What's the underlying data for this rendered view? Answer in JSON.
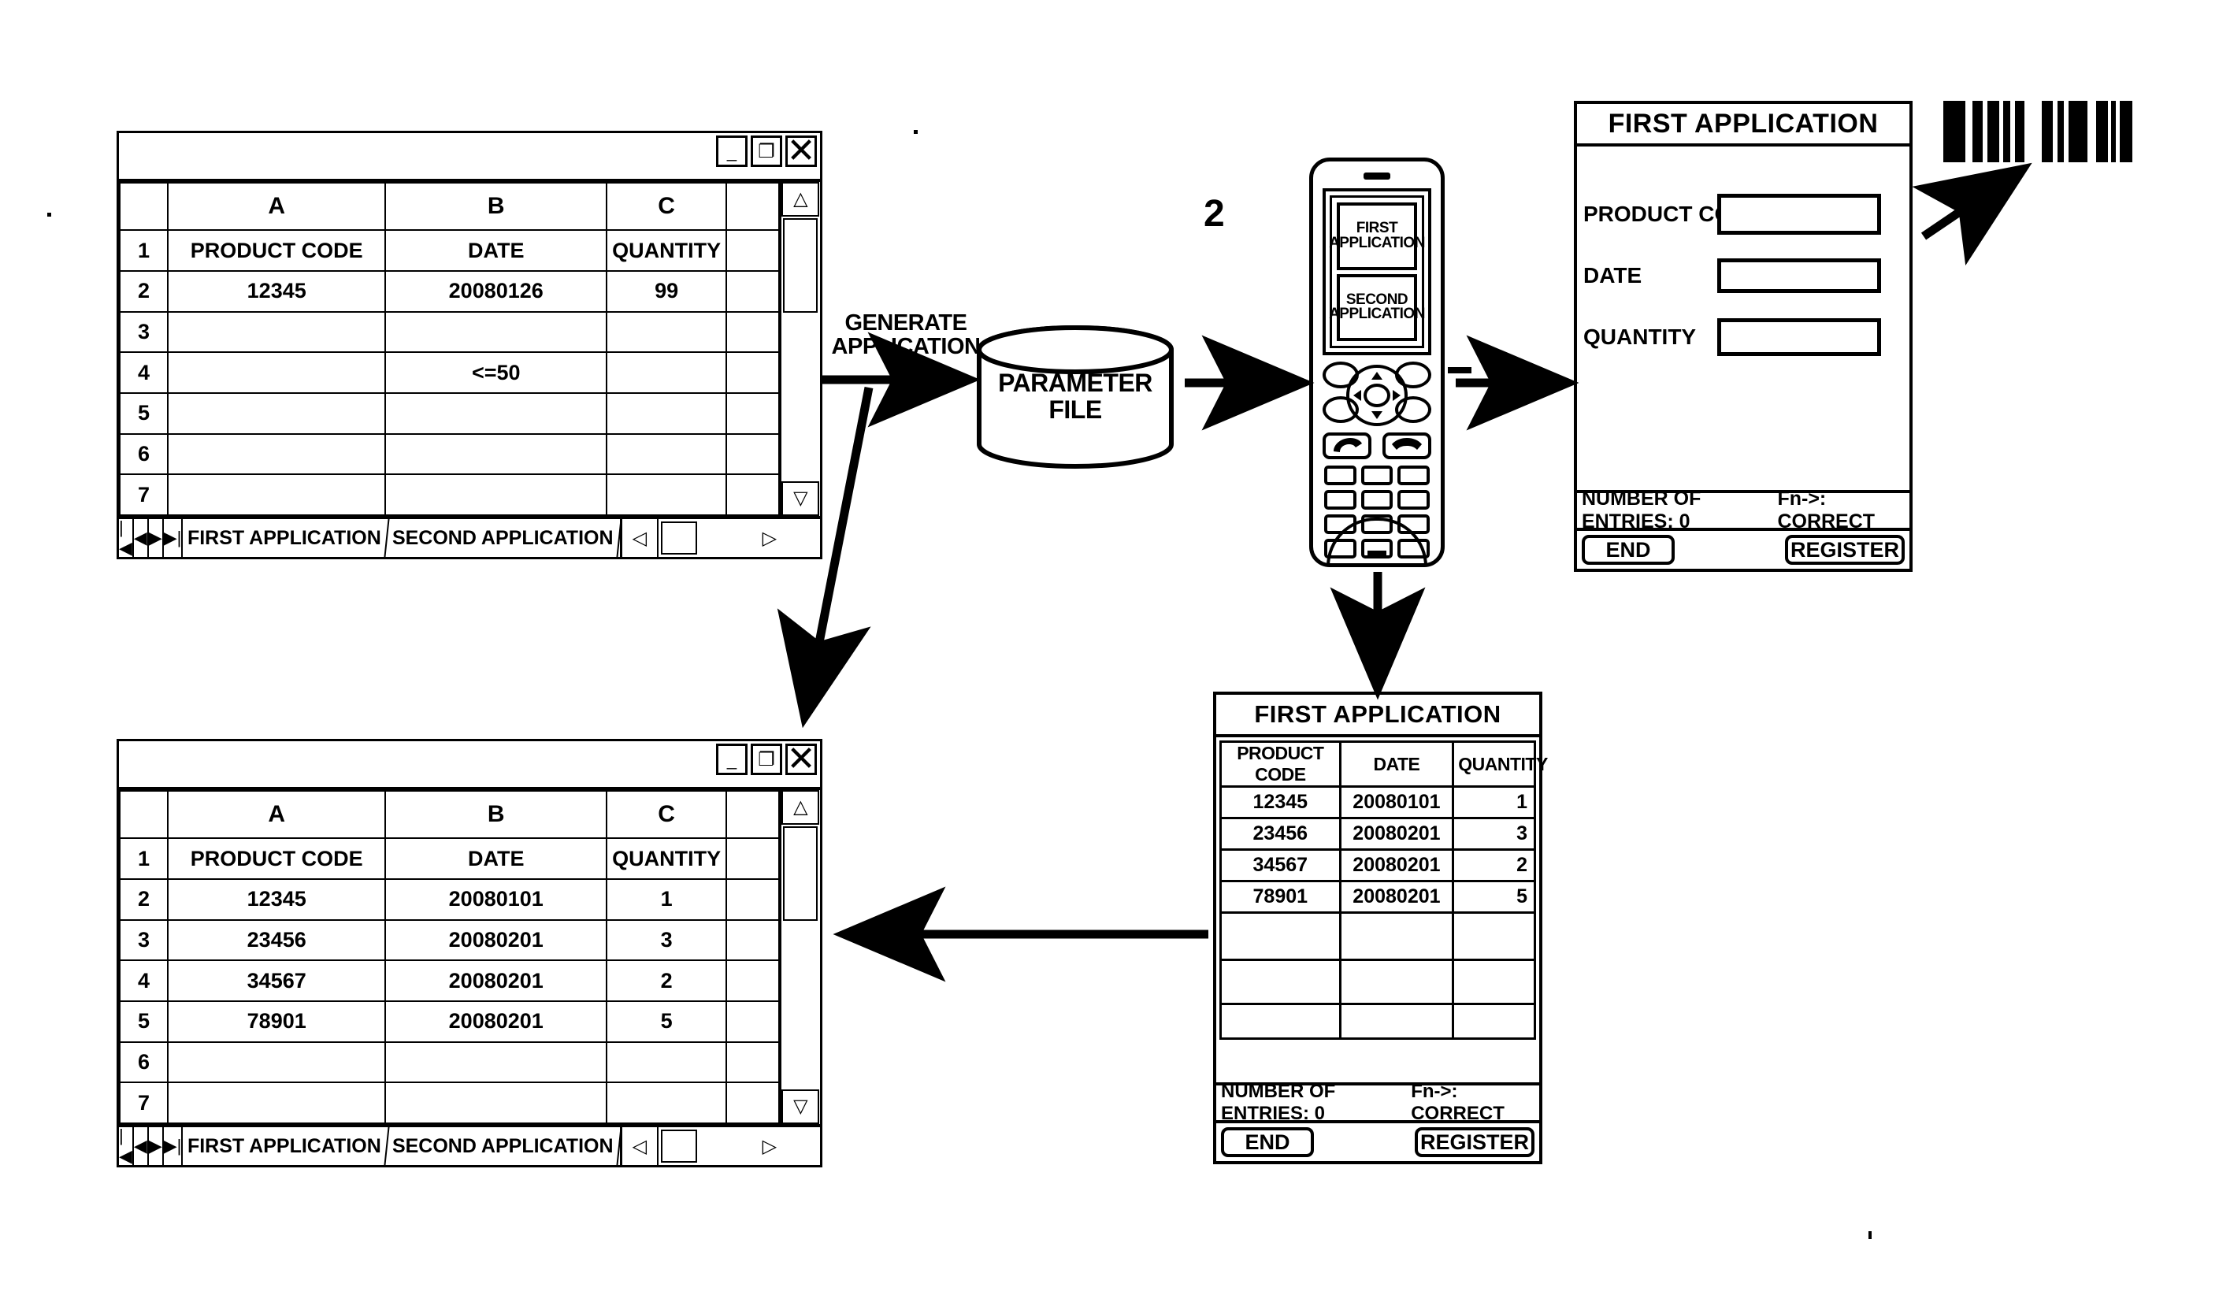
{
  "figure": {
    "reference_numeral": "2",
    "generate_label_line1": "GENERATE",
    "generate_label_line2": "APPLICATION",
    "parameter_file_line1": "PARAMETER",
    "parameter_file_line2": "FILE"
  },
  "spreadsheet_top": {
    "column_headers": [
      "",
      "A",
      "B",
      "C",
      ""
    ],
    "rows": [
      {
        "num": "1",
        "a": "PRODUCT CODE",
        "b": "DATE",
        "c": "QUANTITY"
      },
      {
        "num": "2",
        "a": "12345",
        "b": "20080126",
        "c": "99"
      },
      {
        "num": "3",
        "a": "",
        "b": "",
        "c": ""
      },
      {
        "num": "4",
        "a": "",
        "b": "<=50",
        "c": ""
      },
      {
        "num": "5",
        "a": "",
        "b": "",
        "c": ""
      },
      {
        "num": "6",
        "a": "",
        "b": "",
        "c": ""
      },
      {
        "num": "7",
        "a": "",
        "b": "",
        "c": ""
      }
    ],
    "tabs": [
      "FIRST APPLICATION",
      "SECOND APPLICATION"
    ],
    "nav_first": "|◀",
    "nav_prev": "◀",
    "nav_next": "▶",
    "nav_last": "▶|",
    "scroll_up": "△",
    "scroll_down": "▽",
    "scroll_left": "◁",
    "scroll_right": "▷",
    "win_minimize": "_",
    "win_restore": "❐",
    "win_close": "✕"
  },
  "spreadsheet_bottom": {
    "column_headers": [
      "",
      "A",
      "B",
      "C",
      ""
    ],
    "rows": [
      {
        "num": "1",
        "a": "PRODUCT CODE",
        "b": "DATE",
        "c": "QUANTITY"
      },
      {
        "num": "2",
        "a": "12345",
        "b": "20080101",
        "c": "1"
      },
      {
        "num": "3",
        "a": "23456",
        "b": "20080201",
        "c": "3"
      },
      {
        "num": "4",
        "a": "34567",
        "b": "20080201",
        "c": "2"
      },
      {
        "num": "5",
        "a": "78901",
        "b": "20080201",
        "c": "5"
      },
      {
        "num": "6",
        "a": "",
        "b": "",
        "c": ""
      },
      {
        "num": "7",
        "a": "",
        "b": "",
        "c": ""
      }
    ],
    "tabs": [
      "FIRST APPLICATION",
      "SECOND APPLICATION"
    ],
    "nav_first": "|◀",
    "nav_prev": "◀",
    "nav_next": "▶",
    "nav_last": "▶|",
    "scroll_up": "△",
    "scroll_down": "▽",
    "scroll_left": "◁",
    "scroll_right": "▷",
    "win_minimize": "_",
    "win_restore": "❐",
    "win_close": "✕"
  },
  "phone": {
    "menu_items": [
      {
        "line1": "FIRST",
        "line2": "APPLICATION"
      },
      {
        "line1": "SECOND",
        "line2": "APPLICATION"
      }
    ],
    "call_key": "📞",
    "end_key": "📞"
  },
  "entry_form": {
    "title": "FIRST APPLICATION",
    "fields": [
      {
        "label": "PRODUCT CODE",
        "value": ""
      },
      {
        "label": "DATE",
        "value": ""
      },
      {
        "label": "QUANTITY",
        "value": ""
      }
    ],
    "status_left": "NUMBER OF ENTRIES: 0",
    "status_right": "Fn->: CORRECT",
    "btn_end": "END",
    "btn_register": "REGISTER"
  },
  "list_form": {
    "title": "FIRST APPLICATION",
    "headers": [
      "PRODUCT CODE",
      "DATE",
      "QUANTITY"
    ],
    "rows": [
      {
        "code": "12345",
        "date": "20080101",
        "qty": "1"
      },
      {
        "code": "23456",
        "date": "20080201",
        "qty": "3"
      },
      {
        "code": "34567",
        "date": "20080201",
        "qty": "2"
      },
      {
        "code": "78901",
        "date": "20080201",
        "qty": "5"
      },
      {
        "code": "",
        "date": "",
        "qty": ""
      },
      {
        "code": "",
        "date": "",
        "qty": ""
      },
      {
        "code": "",
        "date": "",
        "qty": ""
      }
    ],
    "status_left": "NUMBER OF ENTRIES: 0",
    "status_right": "Fn->: CORRECT",
    "btn_end": "END",
    "btn_register": "REGISTER"
  },
  "barcode": {
    "widths": [
      22,
      10,
      9,
      10,
      8,
      10,
      5,
      10,
      9,
      28,
      12,
      10,
      8,
      10,
      22,
      12,
      10,
      8,
      19,
      4,
      8,
      4,
      16
    ]
  }
}
